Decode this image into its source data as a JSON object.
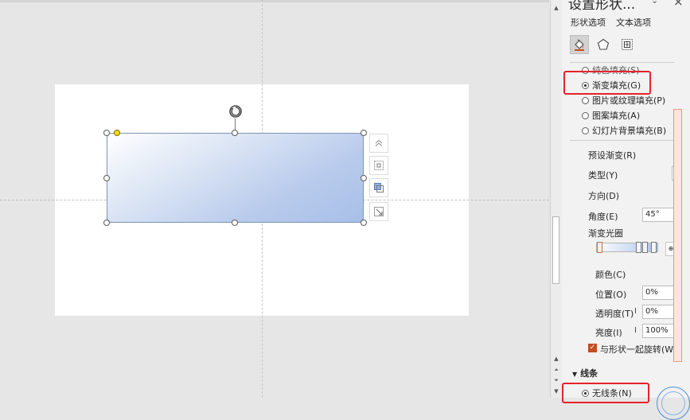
{
  "panel": {
    "title": "设置形状...",
    "tabs": [
      "形状选项",
      "文本选项"
    ],
    "icons": [
      "fill-line-icon",
      "effects-pentagon-icon",
      "size-properties-icon"
    ],
    "fill_options": [
      {
        "label": "纯色填充(S)",
        "selected": false
      },
      {
        "label": "渐变填充(G)",
        "selected": true
      },
      {
        "label": "图片或纹理填充(P)",
        "selected": false
      },
      {
        "label": "图案填充(A)",
        "selected": false
      },
      {
        "label": "幻灯片背景填充(B)",
        "selected": false
      }
    ],
    "preset_gradient_label": "预设渐变(R)",
    "type_label": "类型(Y)",
    "direction_label": "方向(D)",
    "angle_label": "角度(E)",
    "angle_value": "45°",
    "gradient_stops_label": "渐变光圈",
    "color_label": "颜色(C)",
    "position_label": "位置(O)",
    "position_value": "0%",
    "transparency_label": "透明度(T)",
    "transparency_value": "0%",
    "brightness_label": "亮度(I)",
    "brightness_value": "100%",
    "rotate_with_shape_label": "与形状一起旋转(W)",
    "rotate_with_shape_checked": true,
    "line_section_label": "线条",
    "line_options": [
      {
        "label": "无线条(N)",
        "selected": true
      }
    ]
  },
  "colors": {
    "accent_checkbox": "#c04c2a",
    "highlight_box": "#e5232c",
    "shape_gradient_start": "#ffffff",
    "shape_gradient_end": "#a7bfe8"
  }
}
